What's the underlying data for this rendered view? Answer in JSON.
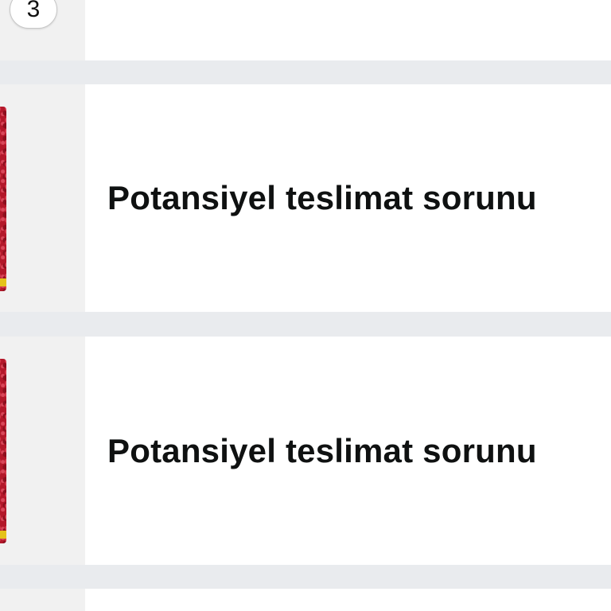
{
  "quantity_badge": "3",
  "orders": [
    {
      "status": "Potansiyel teslimat sorunu"
    },
    {
      "status": "Potansiyel teslimat sorunu"
    }
  ],
  "colors": {
    "background": "#e9ebee",
    "card": "#ffffff",
    "thumbnail_bg": "#f1f1f1",
    "product_red": "#b3182a",
    "product_yellow": "#e5c21a",
    "text": "#0f1111"
  },
  "icons": [
    "product-thumbnail-icon"
  ]
}
